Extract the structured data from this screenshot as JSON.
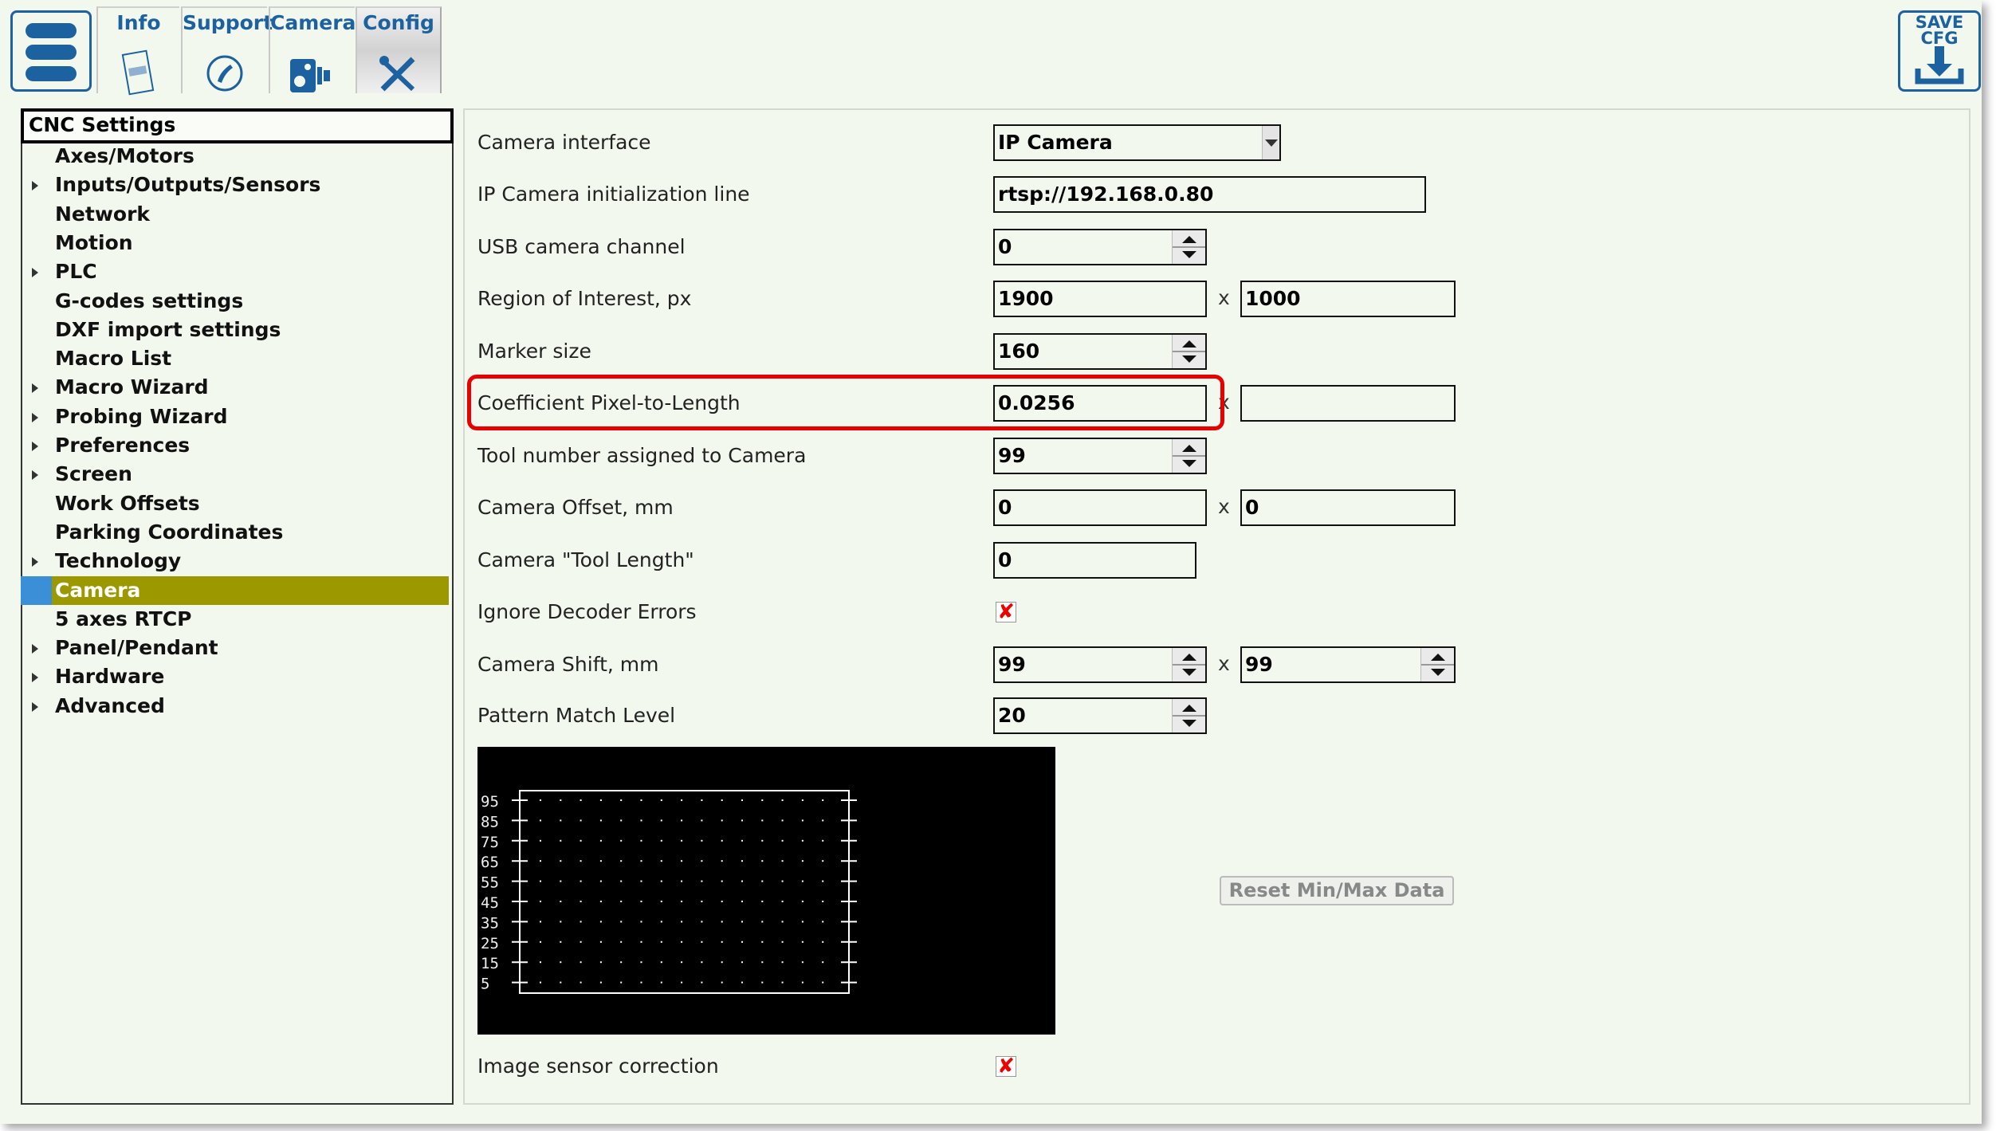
{
  "toolbar": {
    "tabs": [
      {
        "label": "Info",
        "icon": "info-document-icon"
      },
      {
        "label": "Support",
        "icon": "phone-icon"
      },
      {
        "label": "Camera",
        "icon": "camera-icon"
      },
      {
        "label": "Config",
        "icon": "wrench-screwdriver-icon",
        "active": true
      }
    ],
    "save_label_1": "SAVE",
    "save_label_2": "CFG"
  },
  "sidebar": {
    "title": "CNC Settings",
    "items": [
      {
        "label": "Axes/Motors",
        "expandable": false
      },
      {
        "label": "Inputs/Outputs/Sensors",
        "expandable": true
      },
      {
        "label": "Network",
        "expandable": false
      },
      {
        "label": "Motion",
        "expandable": false
      },
      {
        "label": "PLC",
        "expandable": true
      },
      {
        "label": "G-codes settings",
        "expandable": false
      },
      {
        "label": "DXF import settings",
        "expandable": false
      },
      {
        "label": "Macro List",
        "expandable": false
      },
      {
        "label": "Macro Wizard",
        "expandable": true
      },
      {
        "label": "Probing Wizard",
        "expandable": true
      },
      {
        "label": "Preferences",
        "expandable": true
      },
      {
        "label": "Screen",
        "expandable": true
      },
      {
        "label": "Work Offsets",
        "expandable": false
      },
      {
        "label": "Parking Coordinates",
        "expandable": false
      },
      {
        "label": "Technology",
        "expandable": true
      },
      {
        "label": "Camera",
        "expandable": false,
        "selected": true
      },
      {
        "label": "5 axes RTCP",
        "expandable": false
      },
      {
        "label": "Panel/Pendant",
        "expandable": true
      },
      {
        "label": "Hardware",
        "expandable": true
      },
      {
        "label": "Advanced",
        "expandable": true
      }
    ]
  },
  "form": {
    "camera_interface": {
      "label": "Camera interface",
      "value": "IP Camera"
    },
    "ip_init": {
      "label": "IP Camera initialization line",
      "value": "rtsp://192.168.0.80"
    },
    "usb_channel": {
      "label": "USB camera channel",
      "value": "0"
    },
    "roi": {
      "label": "Region of Interest, px",
      "x": "1900",
      "y": "1000",
      "sep": "x"
    },
    "marker_size": {
      "label": "Marker size",
      "value": "160"
    },
    "coef": {
      "label": "Coefficient Pixel-to-Length",
      "x": "0.0256",
      "y": "",
      "sep": "x"
    },
    "tool_number": {
      "label": "Tool number assigned to Camera",
      "value": "99"
    },
    "offset": {
      "label": "Camera Offset, mm",
      "x": "0",
      "y": "0",
      "sep": "x"
    },
    "tool_length": {
      "label": "Camera \"Tool Length\"",
      "value": "0"
    },
    "ignore_errors": {
      "label": "Ignore Decoder Errors",
      "checked": true,
      "mark": "✘"
    },
    "shift": {
      "label": "Camera Shift, mm",
      "x": "99",
      "y": "99",
      "sep": "x"
    },
    "pattern_level": {
      "label": "Pattern Match Level",
      "value": "20"
    },
    "reset_label": "Reset Min/Max Data",
    "sensor_correction": {
      "label": "Image sensor correction",
      "checked": true,
      "mark": "✘"
    }
  },
  "plot": {
    "y_ticks": [
      "95",
      "85",
      "75",
      "65",
      "55",
      "45",
      "35",
      "25",
      "15",
      "5"
    ]
  },
  "colors": {
    "accent": "#1d62a0",
    "selected_bg": "#9c9800",
    "highlight": "#e80000"
  }
}
